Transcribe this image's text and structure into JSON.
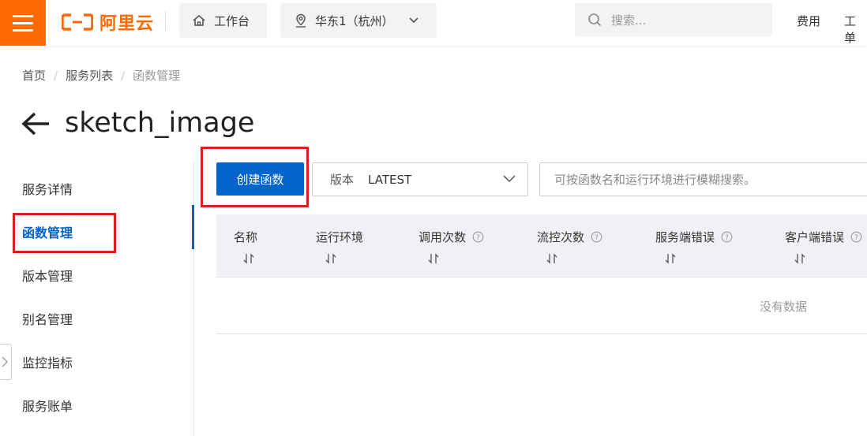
{
  "header": {
    "brand": "阿里云",
    "workbench_label": "工作台",
    "region_label": "华东1（杭州）",
    "search_placeholder": "搜索...",
    "nav": [
      "费用",
      "工单"
    ],
    "brand_color": "#ff6a00"
  },
  "breadcrumb": {
    "items": [
      "首页",
      "服务列表",
      "函数管理"
    ]
  },
  "page": {
    "title": "sketch_image"
  },
  "sidebar": {
    "items": [
      {
        "label": "服务详情",
        "active": false
      },
      {
        "label": "函数管理",
        "active": true
      },
      {
        "label": "版本管理",
        "active": false
      },
      {
        "label": "别名管理",
        "active": false
      },
      {
        "label": "监控指标",
        "active": false
      },
      {
        "label": "服务账单",
        "active": false
      }
    ]
  },
  "toolbar": {
    "create_label": "创建函数",
    "version_prefix": "版本",
    "version_value": "LATEST",
    "search_placeholder": "可按函数名和运行环境进行模糊搜索。"
  },
  "table": {
    "columns": [
      {
        "label": "名称",
        "help": false
      },
      {
        "label": "运行环境",
        "help": false
      },
      {
        "label": "调用次数",
        "help": true
      },
      {
        "label": "流控次数",
        "help": true
      },
      {
        "label": "服务端错误",
        "help": true
      },
      {
        "label": "客户端错误",
        "help": true
      }
    ],
    "empty_text": "没有数据"
  },
  "colors": {
    "accent": "#0064c8",
    "annotation_red": "#d9201d"
  }
}
